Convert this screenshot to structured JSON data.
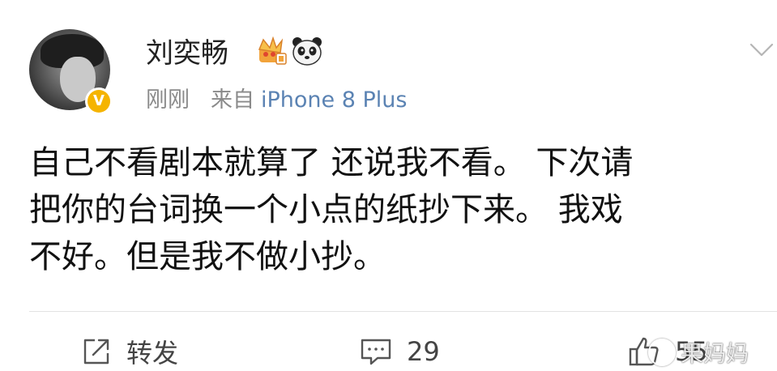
{
  "post": {
    "author": {
      "name": "刘奕畅",
      "verified_mark": "V",
      "badges": [
        "crown-icon",
        "panda-icon"
      ]
    },
    "meta": {
      "time": "刚刚",
      "from_label": "来自",
      "source": "iPhone 8 Plus"
    },
    "content_lines": [
      "自己不看剧本就算了 还说我不看。 下次请",
      "把你的台词换一个小点的纸抄下来。 我戏",
      "不好。但是我不做小抄。"
    ],
    "actions": {
      "repost_label": "转发",
      "comment_count": "29",
      "like_count": "55"
    },
    "watermark": "果妈妈"
  },
  "colors": {
    "text": "#111111",
    "muted": "#8a8a8a",
    "link": "#5b83b3",
    "verified": "#f5b400"
  }
}
